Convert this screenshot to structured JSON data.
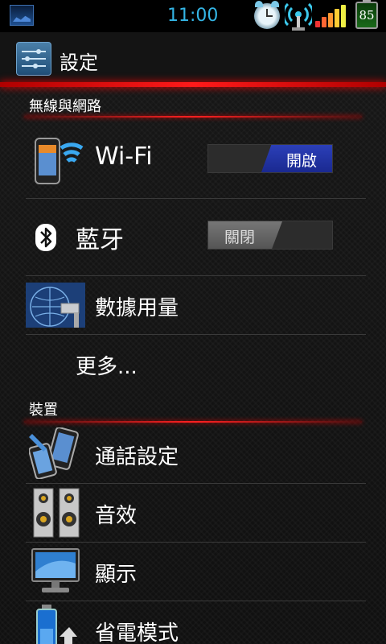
{
  "status_bar": {
    "time": "11:00",
    "battery_level": "85",
    "icons": [
      "gallery-thumbnail-icon",
      "alarm-clock-icon",
      "wireless-antenna-icon",
      "signal-strength-icon",
      "battery-icon"
    ]
  },
  "header": {
    "title": "設定",
    "icon": "settings-sliders-icon"
  },
  "sections": [
    {
      "label": "無線與網路",
      "items": [
        {
          "label": "Wi-Fi",
          "icon": "wifi-phone-icon",
          "toggle": {
            "state": "on",
            "label": "開啟"
          }
        },
        {
          "label": "藍牙",
          "icon": "bluetooth-icon",
          "toggle": {
            "state": "off",
            "label": "關閉"
          }
        },
        {
          "label": "數據用量",
          "icon": "data-usage-icon"
        },
        {
          "label": "更多..."
        }
      ]
    },
    {
      "label": "裝置",
      "items": [
        {
          "label": "通話設定",
          "icon": "call-settings-icon"
        },
        {
          "label": "音效",
          "icon": "speakers-icon"
        },
        {
          "label": "顯示",
          "icon": "monitor-icon"
        },
        {
          "label": "省電模式",
          "icon": "power-saving-icon"
        }
      ]
    }
  ],
  "colors": {
    "accent_red": "#ff1a1a",
    "toggle_on": "#2233aa",
    "toggle_off": "#666666",
    "clock": "#34b5e5"
  }
}
